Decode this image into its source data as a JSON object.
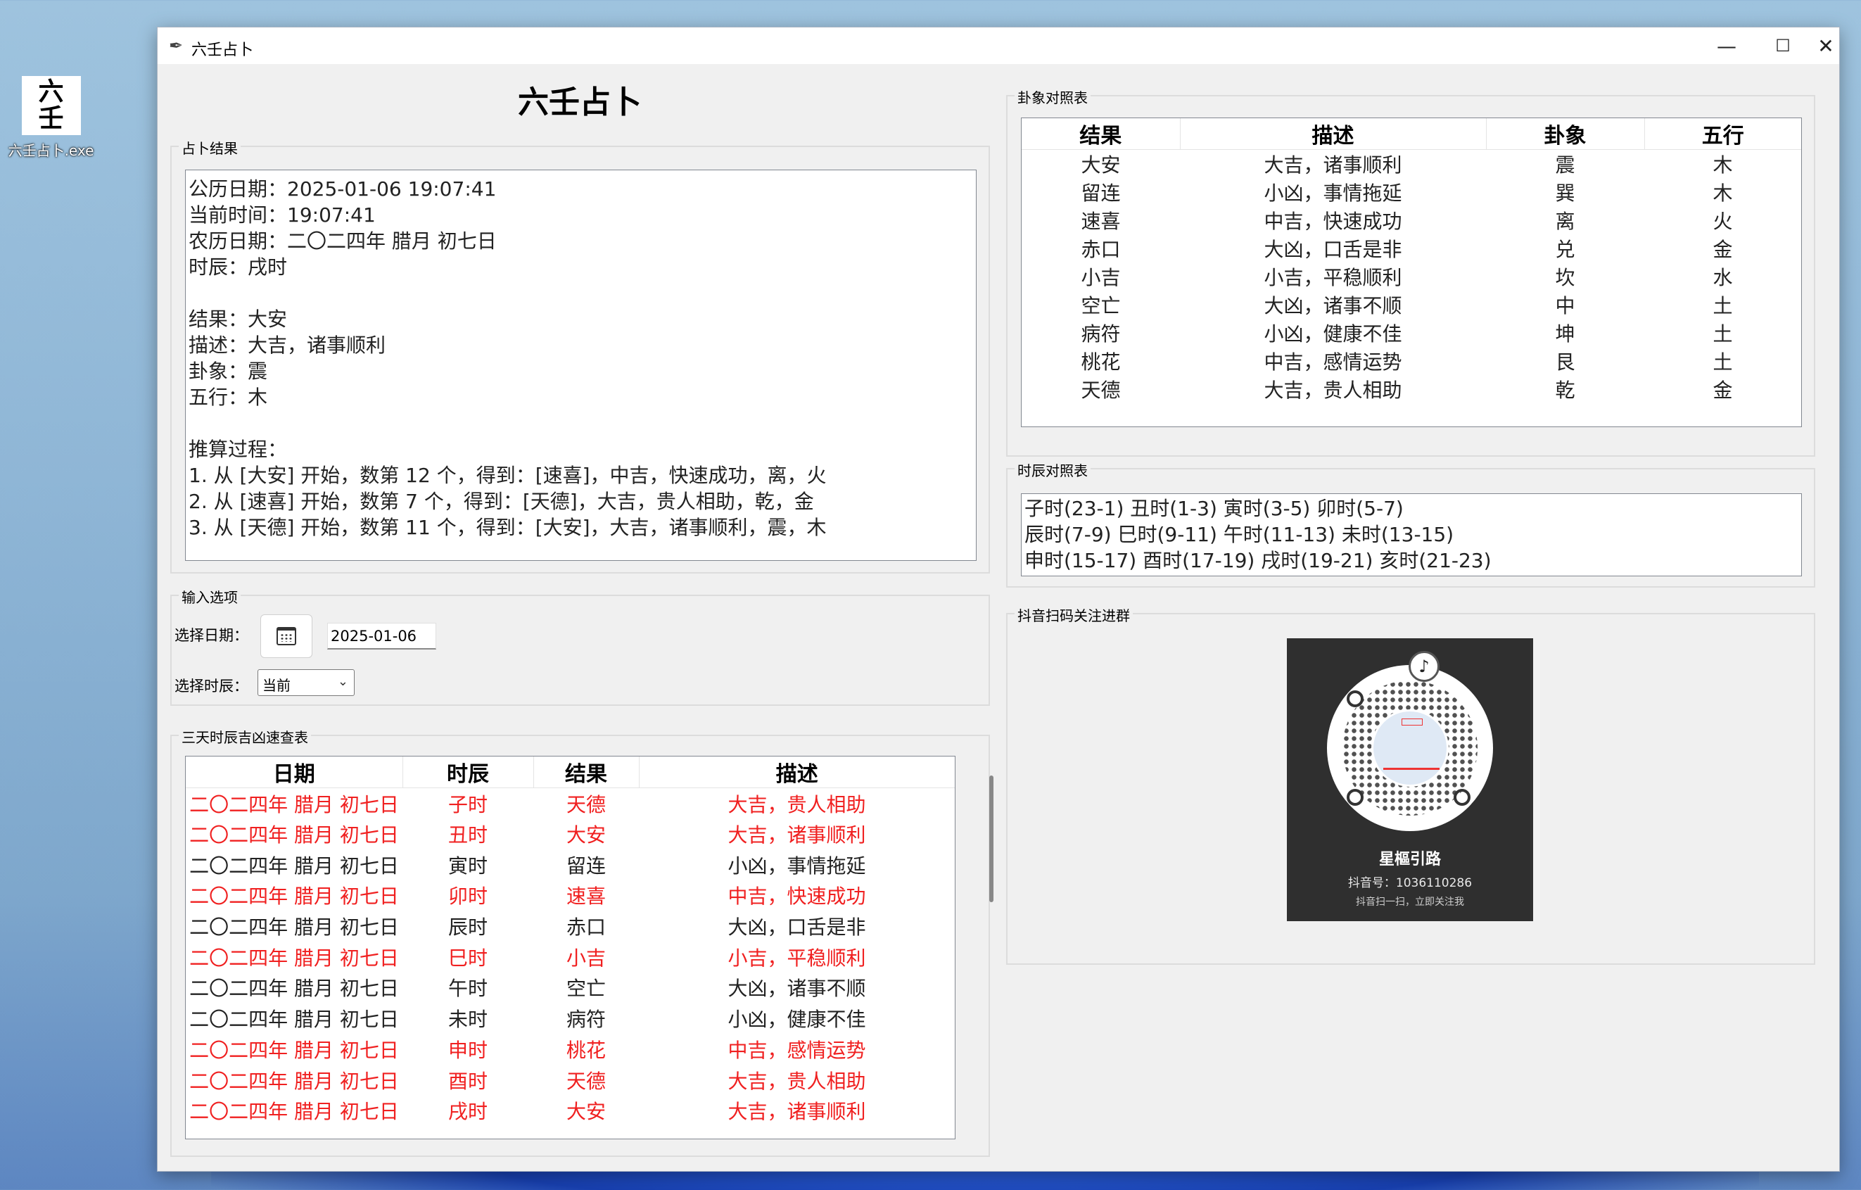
{
  "desktop": {
    "icon_glyph_top": "六",
    "icon_glyph_bottom": "壬",
    "icon_label": "六壬占卜.exe"
  },
  "window": {
    "title": "六壬占卜",
    "minimize": "—",
    "maximize": "☐",
    "close": "✕"
  },
  "main_title": "六壬占卜",
  "result_panel": {
    "label": "占卜结果",
    "lines": [
      "公历日期：2025-01-06 19:07:41",
      "当前时间：19:07:41",
      "农历日期：二〇二四年 腊月 初七日",
      "时辰：戌时",
      "",
      "结果：大安",
      "描述：大吉，诸事顺利",
      "卦象：震",
      "五行：木",
      "",
      "推算过程：",
      "1. 从 [大安] 开始，数第 12 个，得到：[速喜]，中吉，快速成功，离，火",
      "2. 从 [速喜] 开始，数第 7 个，得到：[天德]，大吉，贵人相助，乾，金",
      "3. 从 [天德] 开始，数第 11 个，得到：[大安]，大吉，诸事顺利，震，木"
    ]
  },
  "input_panel": {
    "label": "输入选项",
    "date_label": "选择日期：",
    "date_value": "2025-01-06",
    "time_label": "选择时辰：",
    "time_value": "当前",
    "calendar_icon": "calendar-icon"
  },
  "quick_table": {
    "label": "三天时辰吉凶速查表",
    "headers": [
      "日期",
      "时辰",
      "结果",
      "描述"
    ],
    "rows": [
      {
        "date": "二〇二四年 腊月 初七日",
        "hour": "子时",
        "result": "天德",
        "desc": "大吉，贵人相助",
        "highlight": true
      },
      {
        "date": "二〇二四年 腊月 初七日",
        "hour": "丑时",
        "result": "大安",
        "desc": "大吉，诸事顺利",
        "highlight": true
      },
      {
        "date": "二〇二四年 腊月 初七日",
        "hour": "寅时",
        "result": "留连",
        "desc": "小凶，事情拖延",
        "highlight": false
      },
      {
        "date": "二〇二四年 腊月 初七日",
        "hour": "卯时",
        "result": "速喜",
        "desc": "中吉，快速成功",
        "highlight": true
      },
      {
        "date": "二〇二四年 腊月 初七日",
        "hour": "辰时",
        "result": "赤口",
        "desc": "大凶，口舌是非",
        "highlight": false
      },
      {
        "date": "二〇二四年 腊月 初七日",
        "hour": "巳时",
        "result": "小吉",
        "desc": "小吉，平稳顺利",
        "highlight": true
      },
      {
        "date": "二〇二四年 腊月 初七日",
        "hour": "午时",
        "result": "空亡",
        "desc": "大凶，诸事不顺",
        "highlight": false
      },
      {
        "date": "二〇二四年 腊月 初七日",
        "hour": "未时",
        "result": "病符",
        "desc": "小凶，健康不佳",
        "highlight": false
      },
      {
        "date": "二〇二四年 腊月 初七日",
        "hour": "申时",
        "result": "桃花",
        "desc": "中吉，感情运势",
        "highlight": true
      },
      {
        "date": "二〇二四年 腊月 初七日",
        "hour": "酉时",
        "result": "天德",
        "desc": "大吉，贵人相助",
        "highlight": true
      },
      {
        "date": "二〇二四年 腊月 初七日",
        "hour": "戌时",
        "result": "大安",
        "desc": "大吉，诸事顺利",
        "highlight": true
      }
    ],
    "highlight_color": "#f02020"
  },
  "gua_table": {
    "label": "卦象对照表",
    "headers": [
      "结果",
      "描述",
      "卦象",
      "五行"
    ],
    "rows": [
      [
        "大安",
        "大吉，诸事顺利",
        "震",
        "木"
      ],
      [
        "留连",
        "小凶，事情拖延",
        "巽",
        "木"
      ],
      [
        "速喜",
        "中吉，快速成功",
        "离",
        "火"
      ],
      [
        "赤口",
        "大凶，口舌是非",
        "兑",
        "金"
      ],
      [
        "小吉",
        "小吉，平稳顺利",
        "坎",
        "水"
      ],
      [
        "空亡",
        "大凶，诸事不顺",
        "中",
        "土"
      ],
      [
        "病符",
        "小凶，健康不佳",
        "坤",
        "土"
      ],
      [
        "桃花",
        "中吉，感情运势",
        "艮",
        "土"
      ],
      [
        "天德",
        "大吉，贵人相助",
        "乾",
        "金"
      ]
    ]
  },
  "shichen_panel": {
    "label": "时辰对照表",
    "lines": [
      "子时(23-1) 丑时(1-3) 寅时(3-5) 卯时(5-7)",
      "辰时(7-9) 巳时(9-11) 午时(11-13) 未时(13-15)",
      "申时(15-17) 酉时(17-19) 戌时(19-21) 亥时(21-23)"
    ]
  },
  "qr_panel": {
    "label": "抖音扫码关注进群",
    "name": "星樞引路",
    "id_line": "抖音号：1036110286",
    "tip": "抖音扫一扫，立即关注我",
    "logo_icon": "douyin-icon"
  }
}
